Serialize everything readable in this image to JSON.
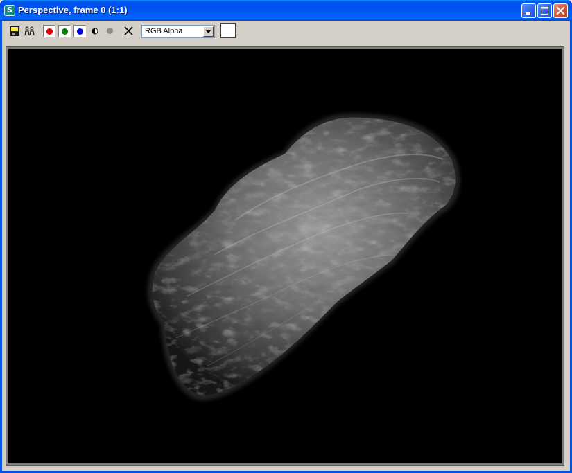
{
  "window": {
    "title": "Perspective, frame 0 (1:1)",
    "app_icon_glyph": "S",
    "buttons": [
      "minimize-icon",
      "maximize-icon",
      "close-icon"
    ]
  },
  "toolbar": {
    "tools": [
      "save-icon",
      "clone-icon",
      "red-channel-icon",
      "green-channel-icon",
      "blue-channel-icon",
      "monochrome-icon",
      "alpha-channel-icon",
      "clear-icon"
    ],
    "channel_display_value": "RGB Alpha",
    "swatch_color": "#ffffff"
  },
  "render": {
    "subject": "asteroid",
    "background_color": "#000000"
  }
}
